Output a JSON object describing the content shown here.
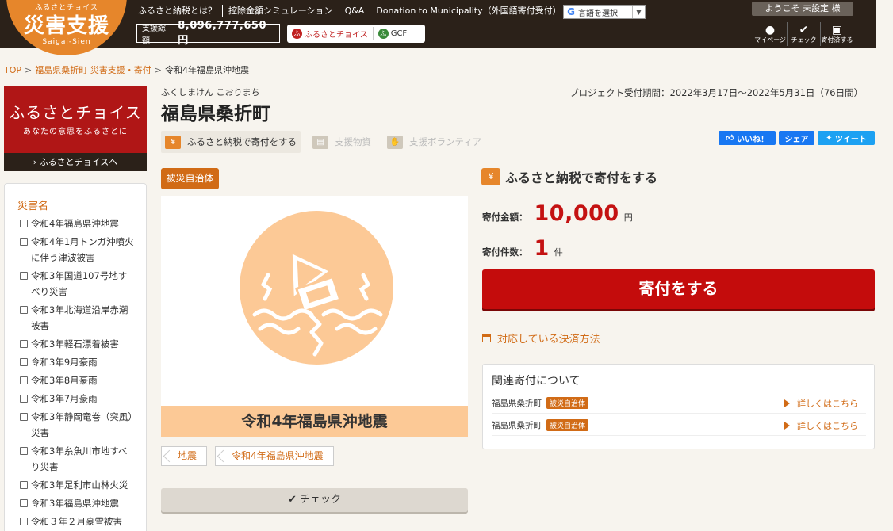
{
  "header": {
    "logo_small": "ふるさとチョイス",
    "logo_main": "災害支援",
    "logo_sub": "Saigai-Sien",
    "nav": [
      "ふるさと納税とは？",
      "控除金額シミュレーション",
      "Q&A",
      "Donation to Municipality（外国語寄付受付）"
    ],
    "language_label": "言語を選択",
    "total_label": "支援総額",
    "total_value": "8,096,777,650 円",
    "furusato_link": "ふるさとチョイス",
    "gcf_link": "GCF",
    "welcome": "ようこそ 未設定 様",
    "icons": [
      {
        "name": "mypage",
        "label": "マイページ"
      },
      {
        "name": "check",
        "label": "チェック"
      },
      {
        "name": "donated",
        "label": "寄付済する"
      }
    ]
  },
  "breadcrumb": {
    "top": "TOP",
    "link": "福島県桑折町 災害支援・寄付",
    "current": "令和4年福島県沖地震"
  },
  "sidebar": {
    "banner_title": "ふるさとチョイス",
    "banner_sub": "あなたの意思をふるさとに",
    "banner_footer": "› ふるさとチョイスへ",
    "panel_title": "災害名",
    "items": [
      "令和4年福島県沖地震",
      "令和4年1月トンガ沖噴火に伴う津波被害",
      "令和3年国道107号地すべり災害",
      "令和3年北海道沿岸赤潮被害",
      "令和3年軽石漂着被害",
      "令和3年9月豪雨",
      "令和3年8月豪雨",
      "令和3年7月豪雨",
      "令和3年静岡竜巻（突風）災害",
      "令和3年糸魚川市地すべり災害",
      "令和3年足利市山林火災",
      "令和3年福島県沖地震",
      "令和３年２月豪雪被害"
    ]
  },
  "main": {
    "kana": "ふくしまけん こおりまち",
    "municipality": "福島県桑折町",
    "period": "プロジェクト受付期間：2022年3月17日～2022年5月31日（76日間）",
    "tabs": [
      {
        "label": "ふるさと納税で寄付をする",
        "icon": "¥"
      },
      {
        "label": "支援物資",
        "icon": "▤"
      },
      {
        "label": "支援ボランティア",
        "icon": "✋"
      }
    ],
    "social": [
      "いいね！",
      "シェア",
      "ツイート"
    ],
    "badge": "被災自治体",
    "hero_caption": "令和4年福島県沖地震",
    "tags": [
      "地震",
      "令和4年福島県沖地震"
    ],
    "check_label": "✔ チェック"
  },
  "donation": {
    "title": "ふるさと納税で寄付をする",
    "amount_label": "寄付金額：",
    "amount_value": "10,000",
    "amount_unit": "円",
    "count_label": "寄付件数：",
    "count_value": "1",
    "count_unit": "件",
    "button_label": "寄付をする",
    "payment_link": "対応している決済方法",
    "related_title": "関連寄付について",
    "related_items": [
      {
        "name": "福島県桑折町",
        "badge": "被災自治体",
        "more": "詳しくはこちら"
      },
      {
        "name": "福島県桑折町",
        "badge": "被災自治体",
        "more": "詳しくはこちら"
      }
    ]
  },
  "colors": {
    "header_bg": "#2b2119",
    "brand_orange": "#e6862b",
    "accent_orange": "#d16b16",
    "donate_red": "#c40c0c",
    "furusato_red": "#b01616",
    "hero_peach": "#fcc996"
  }
}
